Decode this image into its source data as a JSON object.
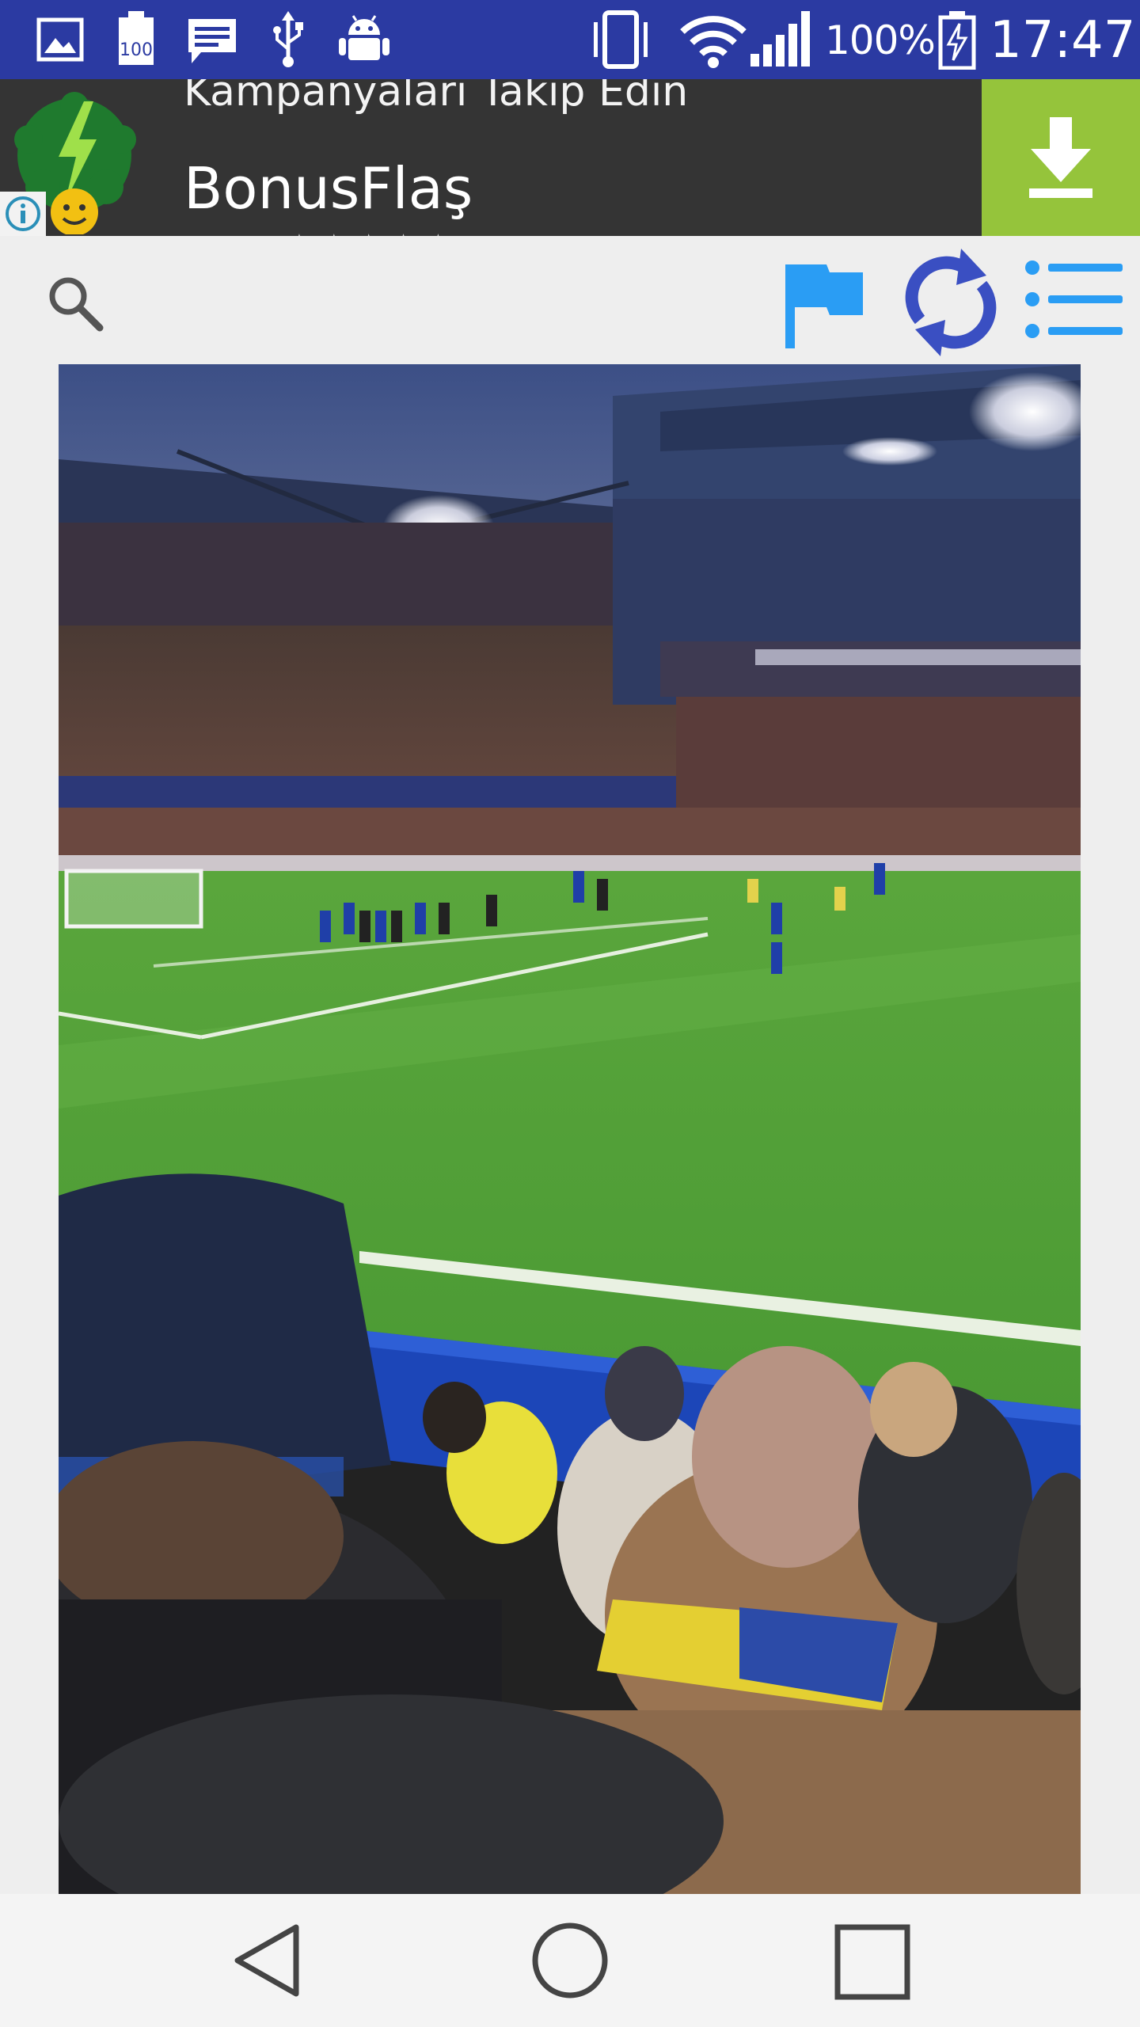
{
  "status_bar": {
    "battery_percent": "100%",
    "time": "17:47",
    "icons": [
      "image-icon",
      "battery-100-icon",
      "message-icon",
      "usb-icon",
      "android-debug-icon",
      "vibrate-icon",
      "wifi-icon",
      "signal-icon",
      "battery-charging-icon"
    ],
    "battery_badge": "100"
  },
  "ad": {
    "subtitle": "Kampanyaları Takip Edin",
    "title": "BonusFlaş",
    "stars": "★★★★★",
    "icons": [
      "bonusflas-logo-icon",
      "info-icon",
      "download-icon"
    ],
    "colors": {
      "background": "#343434",
      "download_bg": "#95c43b",
      "logo_green": "#1f7a2e"
    }
  },
  "toolbar": {
    "icons": [
      "search-icon",
      "flag-icon",
      "refresh-icon",
      "menu-list-icon"
    ],
    "colors": {
      "flag": "#2a9df4",
      "refresh": "#3a4fc2",
      "menu": "#2a9df4"
    }
  },
  "photo": {
    "description_icon": "stadium-photo"
  },
  "nav_bar": {
    "icons": [
      "back-icon",
      "home-icon",
      "recents-icon"
    ]
  }
}
